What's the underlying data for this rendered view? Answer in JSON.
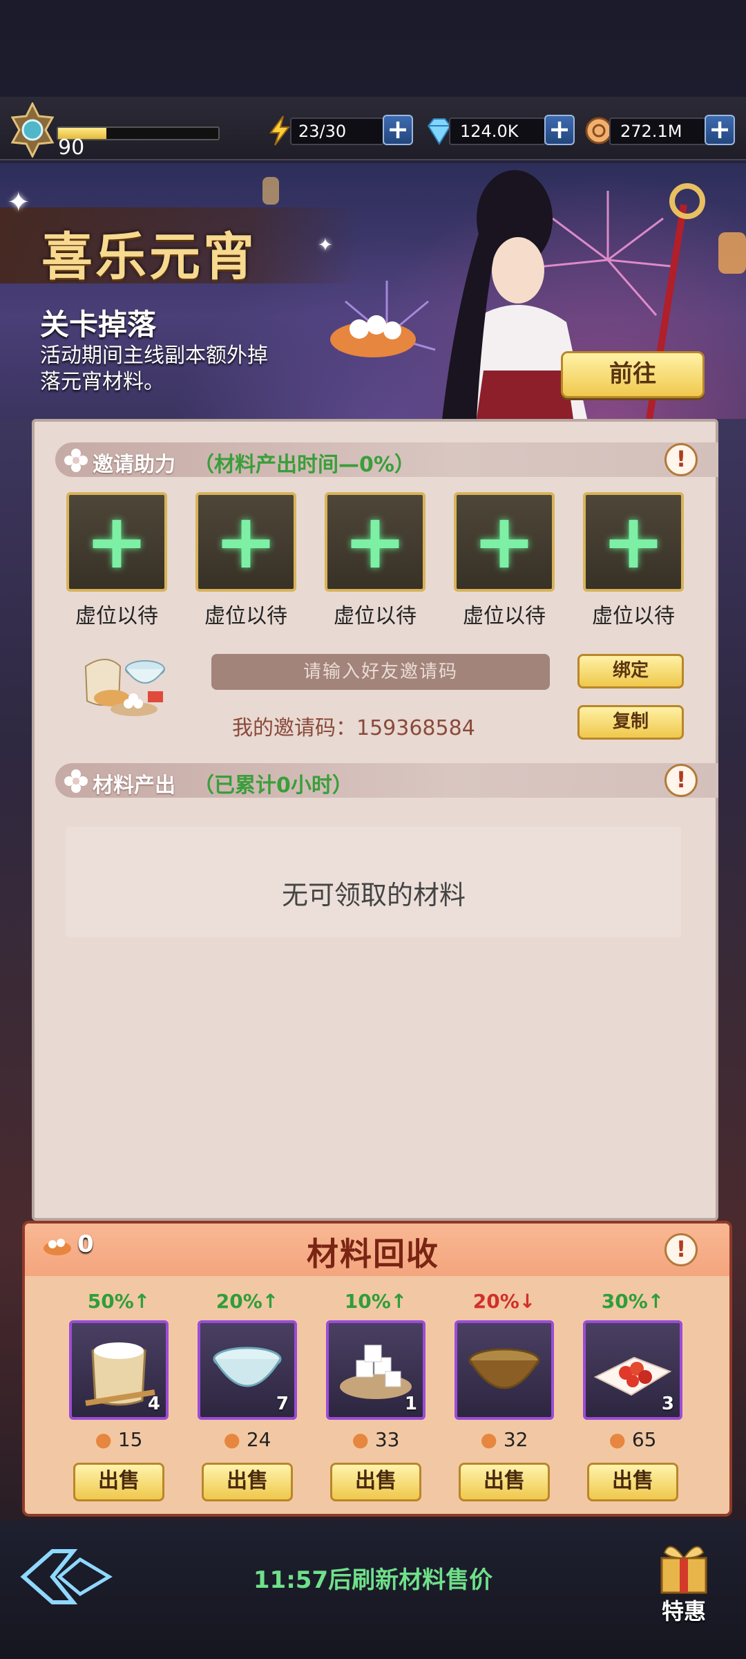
{
  "top": {
    "level": "90",
    "level_progress": 0.3,
    "energy": "23/30",
    "diamonds": "124.0K",
    "coins": "272.1M",
    "plus": "+"
  },
  "banner": {
    "title": "喜乐元宵",
    "subtitle": "关卡掉落",
    "description": "活动期间主线副本额外掉落元宵材料。",
    "go_button": "前往"
  },
  "invite": {
    "title": "邀请助力",
    "note": "（材料产出时间—0%）",
    "info": "!",
    "slots": [
      {
        "plus": "+",
        "label": "虚位以待"
      },
      {
        "plus": "+",
        "label": "虚位以待"
      },
      {
        "plus": "+",
        "label": "虚位以待"
      },
      {
        "plus": "+",
        "label": "虚位以待"
      },
      {
        "plus": "+",
        "label": "虚位以待"
      }
    ],
    "code_placeholder": "请输入好友邀请码",
    "bind_button": "绑定",
    "copy_button": "复制",
    "my_code": "我的邀请码：159368584"
  },
  "output": {
    "title": "材料产出",
    "note": "（已累计0小时）",
    "info": "!",
    "empty_text": "无可领取的材料"
  },
  "recycle": {
    "title": "材料回收",
    "coin_count": "0",
    "info": "!",
    "items": [
      {
        "name": "flour",
        "change": "50%↑",
        "trend": "up",
        "quantity": "4",
        "price": "15",
        "sell": "出售"
      },
      {
        "name": "water-bowl",
        "change": "20%↑",
        "trend": "up",
        "quantity": "7",
        "price": "24",
        "sell": "出售"
      },
      {
        "name": "sugar-cubes",
        "change": "10%↑",
        "trend": "up",
        "quantity": "1",
        "price": "33",
        "sell": "出售"
      },
      {
        "name": "bowl-paste",
        "change": "20%↓",
        "trend": "down",
        "quantity": "",
        "price": "32",
        "sell": "出售"
      },
      {
        "name": "red-filling",
        "change": "30%↑",
        "trend": "up",
        "quantity": "3",
        "price": "65",
        "sell": "出售"
      }
    ]
  },
  "footer": {
    "refresh_text": "11:57后刷新材料售价",
    "gift_label": "特惠"
  },
  "colors": {
    "up": "#2f9e3a",
    "down": "#d0302a",
    "accent_gold": "#efc84c"
  }
}
